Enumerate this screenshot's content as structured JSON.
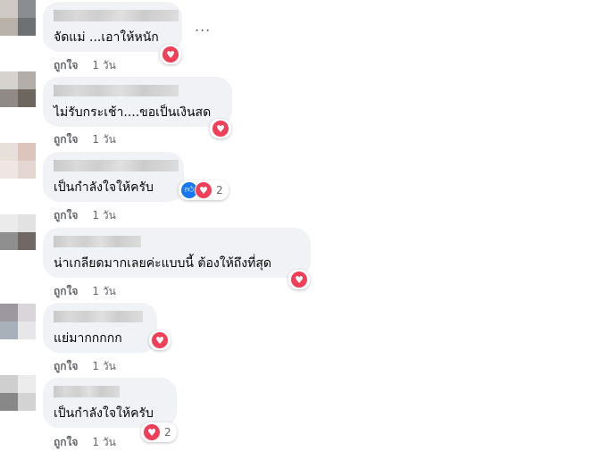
{
  "comments": [
    {
      "text": "จัดแม่ ...เอาให้หนัก",
      "like_label": "ถูกใจ",
      "time": "1 วัน",
      "reaction_count": ""
    },
    {
      "text": "ไม่รับกระเช้า....ขอเป็นเงินสด",
      "like_label": "ถูกใจ",
      "time": "1 วัน",
      "reaction_count": ""
    },
    {
      "text": "เป็นกำลังใจให้ครับ",
      "like_label": "ถูกใจ",
      "time": "1 วัน",
      "reaction_count": "2"
    },
    {
      "text": "น่าเกลียดมากเลยค่ะแบบนี้ ต้องให้ถึงที่สุด",
      "like_label": "ถูกใจ",
      "time": "1 วัน",
      "reaction_count": ""
    },
    {
      "text": "แย่มากกกกก",
      "like_label": "ถูกใจ",
      "time": "1 วัน",
      "reaction_count": ""
    },
    {
      "text": "เป็นกำลังใจให้ครับ",
      "like_label": "ถูกใจ",
      "time": "1 วัน",
      "reaction_count": "2"
    }
  ],
  "more_glyph": "...",
  "icons": {
    "love": "heart-icon",
    "like": "thumbs-up-icon",
    "more": "more-options-icon"
  },
  "colors": {
    "bubble": "#f0f2f5",
    "love": "#f33e58",
    "like": "#1877f2",
    "meta": "#65676b"
  }
}
